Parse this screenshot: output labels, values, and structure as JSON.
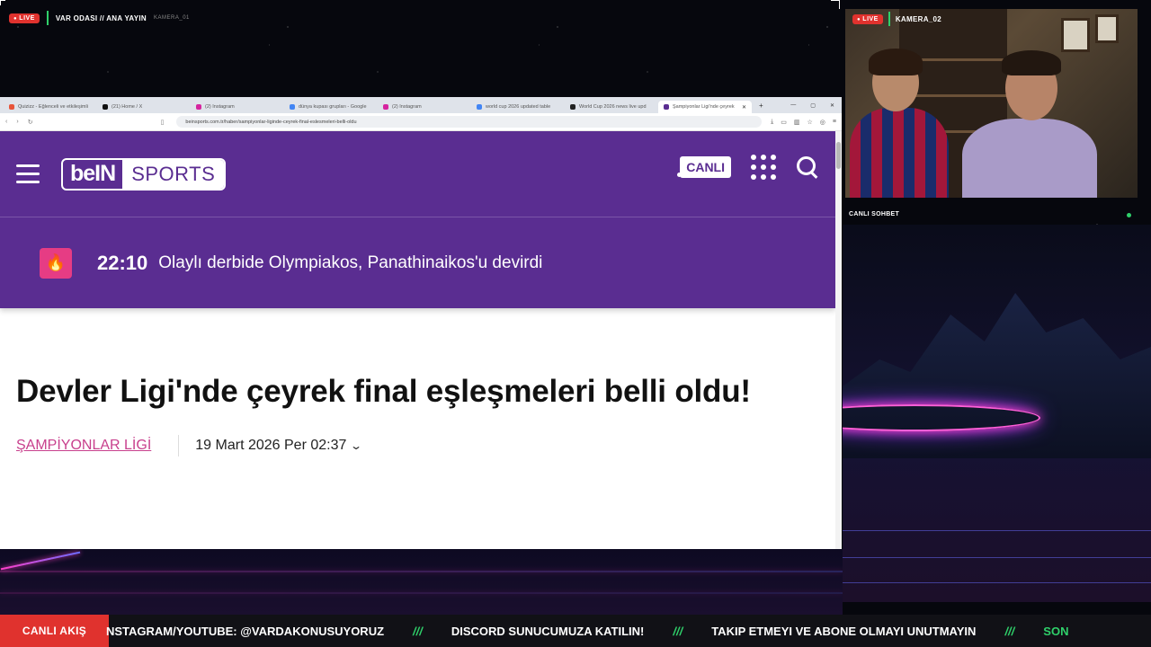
{
  "overlay": {
    "live_label": "LIVE",
    "main_title": "VAR ODASI // ANA YAYIN",
    "main_cam": "KAMERA_01",
    "cam2_live_label": "LIVE",
    "cam2_label": "KAMERA_02",
    "chat_label": "CANLI SOHBET",
    "news_label": "CANLI AKIŞ",
    "news_items": [
      "NSTAGRAM/YOUTUBE: @VARDAKONUSUYORUZ",
      "DISCORD SUNUCUMUZA KATILIN!",
      "TAKIP ETMEYI VE ABONE OLMAYI UNUTMAYIN",
      "SON"
    ],
    "news_separator": "///",
    "accent_live": "#e0322e",
    "accent_green": "#2fd06a"
  },
  "browser": {
    "tabs": [
      {
        "label": "Quizizz - Eğlenceli ve etkileşimli"
      },
      {
        "label": "(21) Home / X"
      },
      {
        "label": "(2) Instagram"
      },
      {
        "label": "dünya kupası grupları - Google"
      },
      {
        "label": "(2) Instagram"
      },
      {
        "label": "world cup 2026 updated table"
      },
      {
        "label": "World Cup 2026 news live upd"
      },
      {
        "label": "Şampiyonlar Ligi'nde çeyrek"
      }
    ],
    "url": "beinsports.com.tr/haber/sampiyonlar-liginde-ceyrek-final-eslesmeleri-belli-oldu"
  },
  "site": {
    "brand_color": "#5a2d91",
    "logo_left": "beIN",
    "logo_right": "SPORTS",
    "live_button": "CANLI",
    "ticker_time": "22:10",
    "ticker_text": "Olaylı derbide Olympiakos, Panathinaikos'u devirdi",
    "article_title": "Devler Ligi'nde çeyrek final eşleşmeleri belli oldu!",
    "category": "ŞAMPİYONLAR LİGİ",
    "category_color": "#c8408d",
    "date": "19 Mart 2026 Per 02:37"
  }
}
